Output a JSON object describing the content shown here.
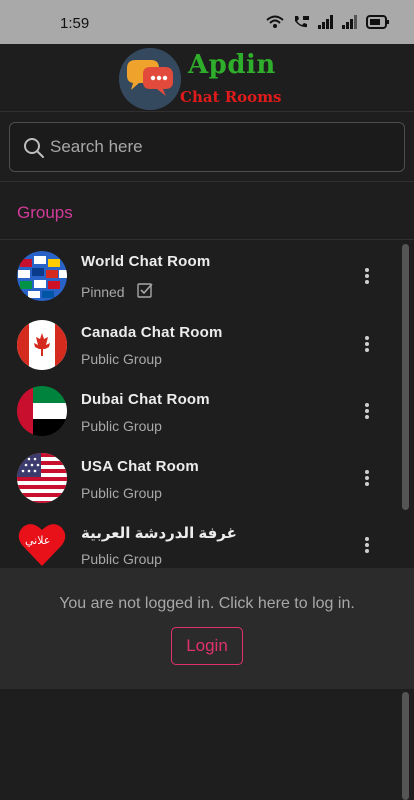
{
  "status_bar": {
    "time": "1:59",
    "icons": [
      "wifi-icon",
      "volte-call-icon",
      "signal-icon",
      "signal-icon",
      "battery-icon"
    ]
  },
  "header": {
    "logo_title": "Apdin",
    "logo_subtitle": "Chat Rooms",
    "colors": {
      "title": "#2fae2b",
      "subtitle": "#e11b1b"
    }
  },
  "search": {
    "placeholder": "Search here",
    "value": ""
  },
  "section": {
    "title": "Groups",
    "color": "#d23b9a"
  },
  "groups": [
    {
      "name": "World Chat Room",
      "subtitle": "Pinned",
      "pinned": true,
      "avatar": "world-flags-icon"
    },
    {
      "name": "Canada Chat Room",
      "subtitle": "Public Group",
      "pinned": false,
      "avatar": "canada-flag-icon"
    },
    {
      "name": "Dubai Chat Room",
      "subtitle": "Public Group",
      "pinned": false,
      "avatar": "uae-flag-icon"
    },
    {
      "name": "USA Chat Room",
      "subtitle": "Public Group",
      "pinned": false,
      "avatar": "usa-flag-icon"
    },
    {
      "name": "غرفة الدردشة العربية",
      "subtitle": "Public Group",
      "pinned": false,
      "avatar": "heart-icon",
      "avatar_text": "علاني"
    }
  ],
  "login": {
    "message": "You are not logged in. Click here to log in.",
    "button_label": "Login",
    "accent": "#e0316f"
  }
}
